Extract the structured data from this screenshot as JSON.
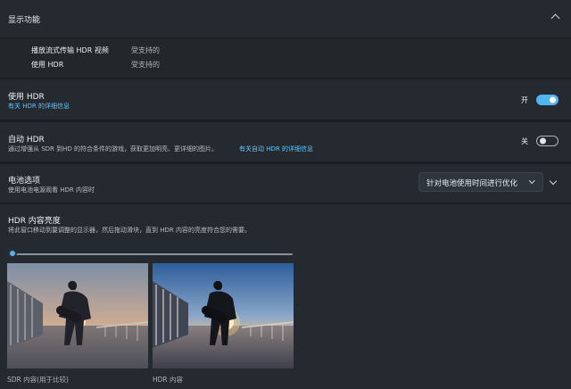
{
  "header": {
    "title": "显示功能"
  },
  "capabilities": [
    {
      "label": "播放流式传输 HDR 视频",
      "value": "受支持的"
    },
    {
      "label": "使用 HDR",
      "value": "受支持的"
    }
  ],
  "use_hdr": {
    "title": "使用 HDR",
    "link": "有关 HDR 的详细信息",
    "state_label": "开",
    "on": true
  },
  "auto_hdr": {
    "title": "自动 HDR",
    "desc": "通过增强从 SDR 到HD 的符合条件的游戏，获取更加明亮、更详细的图片。",
    "link": "有关自动 HDR 的详细信息",
    "state_label": "关",
    "on": false
  },
  "battery": {
    "title": "电池选项",
    "desc": "使用电池电源观看 HDR 内容时",
    "dropdown_value": "针对电池使用时间进行优化"
  },
  "brightness": {
    "title": "HDR 内容亮度",
    "desc": "将此窗口移动到要调整的显示器，然后拖动滑块，直到 HDR 内容的亮度符合您的需要。",
    "slider_level": 0.0
  },
  "previews": [
    {
      "caption": "SDR 内容(用于比较)"
    },
    {
      "caption": "HDR 内容"
    }
  ],
  "colors": {
    "accent": "#4fb4f0",
    "link": "#5cc8ff",
    "background": "#1b1f24",
    "card": "#252a30"
  }
}
